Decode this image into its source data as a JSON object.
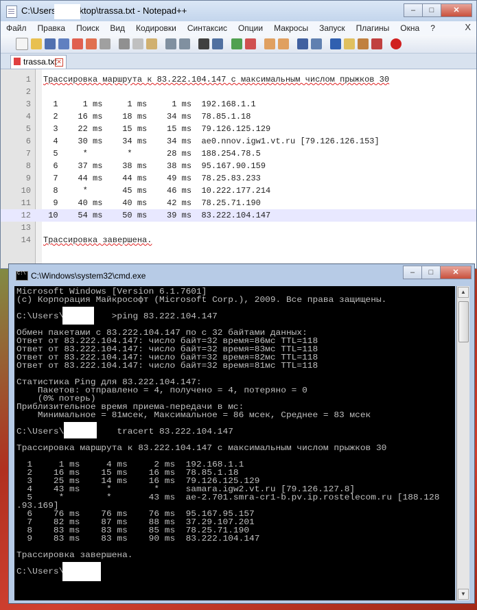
{
  "npp": {
    "title": "C:\\Users\\          \\Desktop\\trassa.txt - Notepad++",
    "window_buttons": [
      "–",
      "□",
      "✕"
    ],
    "menu": [
      "Файл",
      "Правка",
      "Поиск",
      "Вид",
      "Кодировки",
      "Синтаксис",
      "Опции",
      "Макросы",
      "Запуск",
      "Плагины",
      "Окна",
      "?"
    ],
    "menu_close": "X",
    "tab_label": "trassa.txt",
    "tab_close": "✕",
    "lines": [
      {
        "n": "1",
        "text": "Трассировка маршрута к 83.222.104.147 с максимальным числом прыжков 30"
      },
      {
        "n": "2",
        "text": ""
      },
      {
        "n": "3",
        "text": "  1     1 ms     1 ms     1 ms  192.168.1.1"
      },
      {
        "n": "4",
        "text": "  2    16 ms    18 ms    34 ms  78.85.1.18"
      },
      {
        "n": "5",
        "text": "  3    22 ms    15 ms    15 ms  79.126.125.129"
      },
      {
        "n": "6",
        "text": "  4    30 ms    34 ms    34 ms  ae0.nnov.igw1.vt.ru [79.126.126.153]"
      },
      {
        "n": "7",
        "text": "  5     *        *       28 ms  188.254.78.5"
      },
      {
        "n": "8",
        "text": "  6    37 ms    38 ms    38 ms  95.167.90.159"
      },
      {
        "n": "9",
        "text": "  7    44 ms    44 ms    49 ms  78.25.83.233"
      },
      {
        "n": "10",
        "text": "  8     *       45 ms    46 ms  10.222.177.214"
      },
      {
        "n": "11",
        "text": "  9    40 ms    40 ms    42 ms  78.25.71.190"
      },
      {
        "n": "12",
        "text": " 10    54 ms    50 ms    39 ms  83.222.104.147"
      },
      {
        "n": "13",
        "text": ""
      },
      {
        "n": "14",
        "text": "Трассировка завершена."
      }
    ]
  },
  "cmd": {
    "title": "C:\\Windows\\system32\\cmd.exe",
    "window_buttons": [
      "–",
      "□",
      "✕"
    ],
    "lines": [
      "Microsoft Windows [Version 6.1.7601]",
      "(c) Корпорация Майкрософт (Microsoft Corp.), 2009. Все права защищены.",
      "",
      "C:\\Users\\         >ping 83.222.104.147",
      "",
      "Обмен пакетами с 83.222.104.147 по с 32 байтами данных:",
      "Ответ от 83.222.104.147: число байт=32 время=86мс TTL=118",
      "Ответ от 83.222.104.147: число байт=32 время=83мс TTL=118",
      "Ответ от 83.222.104.147: число байт=32 время=82мс TTL=118",
      "Ответ от 83.222.104.147: число байт=32 время=81мс TTL=118",
      "",
      "Статистика Ping для 83.222.104.147:",
      "    Пакетов: отправлено = 4, получено = 4, потеряно = 0",
      "    (0% потерь)",
      "Приблизительное время приема-передачи в мс:",
      "    Минимальное = 81мсек, Максимальное = 86 мсек, Среднее = 83 мсек",
      "",
      "C:\\Users\\          tracert 83.222.104.147",
      "",
      "Трассировка маршрута к 83.222.104.147 с максимальным числом прыжков 30",
      "",
      "  1     1 ms     4 ms     2 ms  192.168.1.1",
      "  2    16 ms    15 ms    16 ms  78.85.1.18",
      "  3    25 ms    14 ms    16 ms  79.126.125.129",
      "  4    43 ms     *        *     samara.igw2.vt.ru [79.126.127.8]",
      "  5     *        *       43 ms  ae-2.701.smra-cr1-b.pv.ip.rostelecom.ru [188.128",
      ".93.169]",
      "  6    76 ms    76 ms    76 ms  95.167.95.157",
      "  7    82 ms    87 ms    88 ms  37.29.107.201",
      "  8    83 ms    83 ms    85 ms  78.25.71.190",
      "  9    83 ms    83 ms    90 ms  83.222.104.147",
      "",
      "Трассировка завершена.",
      "",
      "C:\\Users\\"
    ]
  }
}
